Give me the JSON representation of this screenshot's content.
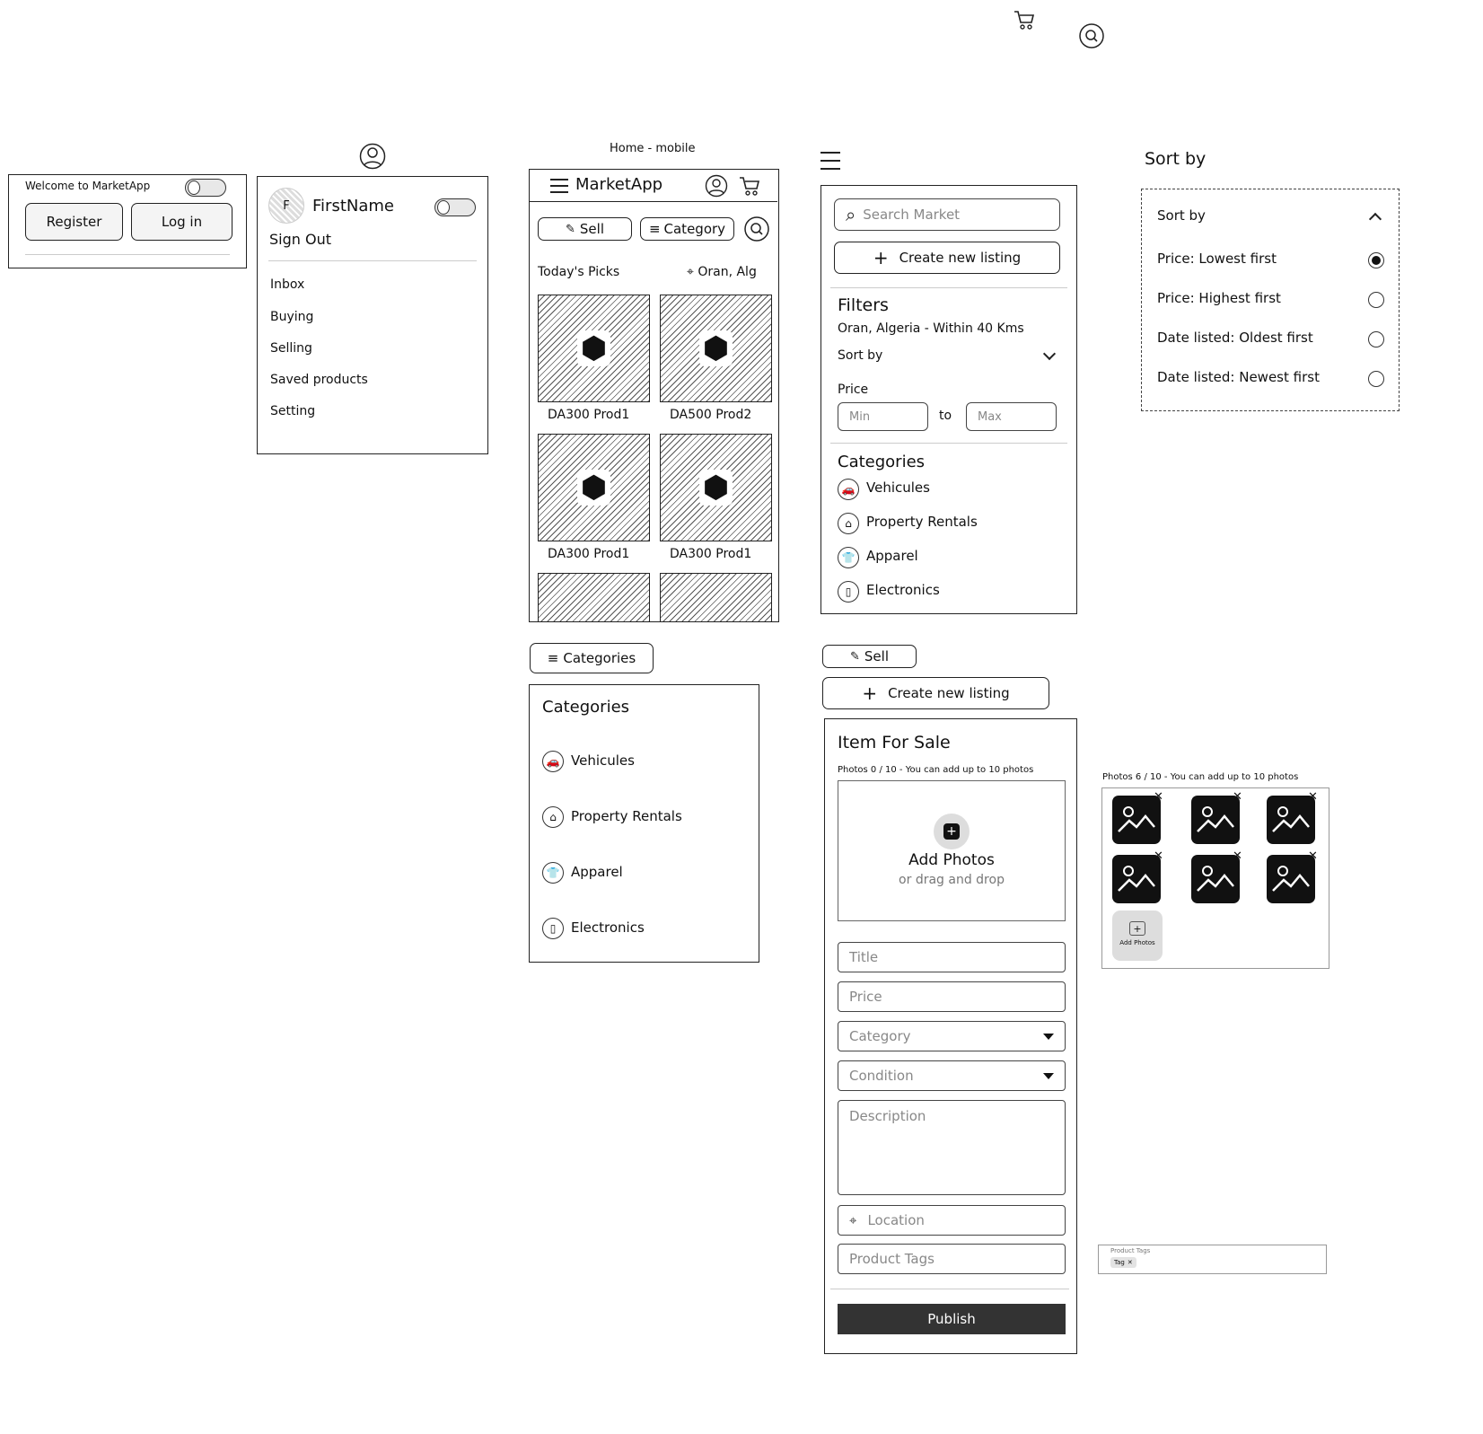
{
  "top": {
    "cart_icon": "cart-icon",
    "search_icon": "search-icon"
  },
  "welcome": {
    "title": "Welcome to MarketApp",
    "register": "Register",
    "login": "Log in"
  },
  "profile_menu": {
    "avatar_letter": "F",
    "name": "FirstName",
    "sign_out": "Sign Out",
    "items": [
      "Inbox",
      "Buying",
      "Selling",
      "Saved products",
      "Setting"
    ]
  },
  "home": {
    "caption": "Home - mobile",
    "app_name": "MarketApp",
    "sell": "Sell",
    "category": "Category",
    "todays_picks": "Today's Picks",
    "location": "Oran, Alg",
    "products": [
      {
        "label": "DA300 Prod1"
      },
      {
        "label": "DA500 Prod2"
      },
      {
        "label": "DA300 Prod1"
      },
      {
        "label": "DA300 Prod1"
      }
    ]
  },
  "categories_panel": {
    "button": "Categories",
    "title": "Categories",
    "items": [
      "Vehicules",
      "Property Rentals",
      "Apparel",
      "Electronics"
    ]
  },
  "filters_panel": {
    "search_placeholder": "Search Market",
    "create_listing": "Create new listing",
    "filters_title": "Filters",
    "location": "Oran, Algeria - Within 40 Kms",
    "sort_by": "Sort by",
    "price_label": "Price",
    "min": "Min",
    "to": "to",
    "max": "Max",
    "categories_title": "Categories",
    "categories": [
      "Vehicules",
      "Property Rentals",
      "Apparel",
      "Electronics"
    ]
  },
  "sort_panel": {
    "heading": "Sort by",
    "dropdown_label": "Sort by",
    "options": [
      {
        "label": "Price: Lowest first",
        "selected": true
      },
      {
        "label": "Price: Highest first",
        "selected": false
      },
      {
        "label": "Date listed: Oldest first",
        "selected": false
      },
      {
        "label": "Date listed: Newest first",
        "selected": false
      }
    ]
  },
  "sell_form": {
    "sell_button": "Sell",
    "create_listing": "Create new listing",
    "title": "Item For Sale",
    "photos_note": "Photos 0 / 10 - You can add up to 10 photos",
    "add_photos": "Add Photos",
    "drag_drop": "or drag and drop",
    "fields": {
      "title": "Title",
      "price": "Price",
      "category": "Category",
      "condition": "Condition",
      "description": "Description",
      "location": "Location",
      "tags": "Product Tags"
    },
    "publish": "Publish"
  },
  "photos_preview": {
    "note": "Photos 6 / 10 - You can add up to 10 photos",
    "add_photos": "Add Photos",
    "photo_count": 6
  },
  "tags_preview": {
    "label": "Product Tags",
    "tag": "Tag"
  }
}
